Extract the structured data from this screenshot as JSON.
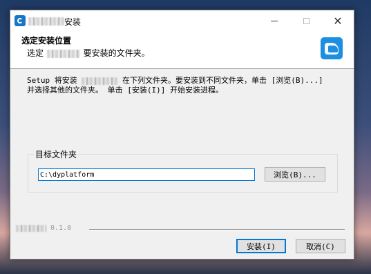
{
  "window": {
    "title": "安装"
  },
  "header": {
    "title": "选定安装位置",
    "subtitle_prefix": "选定",
    "subtitle_suffix": "要安装的文件夹。"
  },
  "content": {
    "line1_prefix": "Setup 将安装",
    "line1_suffix": "在下列文件夹。要安装到不同文件夹，单击 [浏览(B)...]",
    "line2": "并选择其他的文件夹。 单击 [安装(I)] 开始安装进程。"
  },
  "destination": {
    "group_label": "目标文件夹",
    "path_value": "C:\\dyplatform",
    "browse_label": "浏览(B)..."
  },
  "footer": {
    "version": "0.1.0",
    "install_label": "安装(I)",
    "cancel_label": "取消(C)"
  },
  "icons": {
    "app": "installer-app-icon",
    "header_logo": "product-logo-icon",
    "minimize": "minimize-icon",
    "maximize": "maximize-icon",
    "close": "close-icon"
  },
  "colors": {
    "accent": "#0078d7",
    "logo": "#1c8fe0"
  }
}
